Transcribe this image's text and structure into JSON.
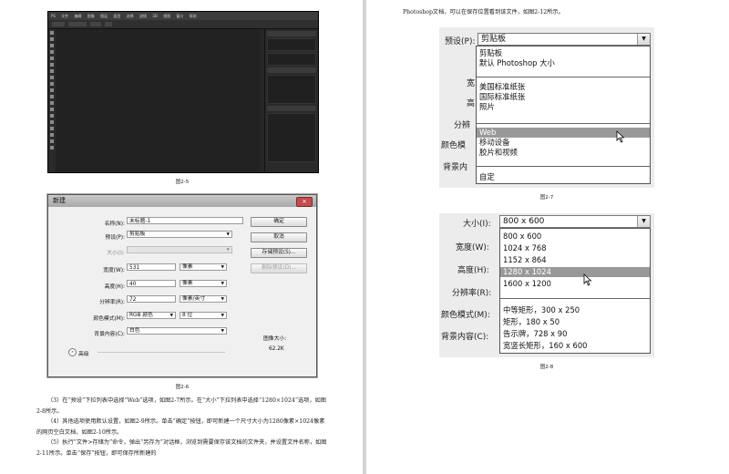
{
  "left_page": {
    "figure5_caption": "图2-5",
    "photoshop": {
      "menu": [
        "PS",
        "文件",
        "编辑",
        "图像",
        "图层",
        "类型",
        "选择",
        "滤镜",
        "3D",
        "视图",
        "窗口",
        "帮助"
      ]
    },
    "new_dialog": {
      "title": "新建",
      "close_label": "✕",
      "name_label": "名称(N):",
      "name_value": "未标题-1",
      "preset_label": "预设(P):",
      "preset_value": "剪贴板",
      "size_label": "大小(I):",
      "width_label": "宽度(W):",
      "width_value": "531",
      "width_unit": "像素",
      "height_label": "高度(H):",
      "height_value": "40",
      "height_unit": "像素",
      "resolution_label": "分辨率(R):",
      "resolution_value": "72",
      "resolution_unit": "像素/英寸",
      "color_mode_label": "颜色模式(M):",
      "color_mode_value": "RGB 颜色",
      "bit_depth_value": "8 位",
      "background_label": "背景内容(C):",
      "background_value": "白色",
      "advanced_label": "高级",
      "ok_label": "确定",
      "cancel_label": "取消",
      "save_preset_label": "存储预设(S)...",
      "delete_preset_label": "删除预设(D)...",
      "image_size_label": "图像大小:",
      "image_size_value": "62.2K"
    },
    "figure6_caption": "图2-6",
    "paragraphs": [
      "（3）在“预设”下拉列表中选择“Web”选项，如图2-7所示。在“大小”下拉列表中选择“1280×1024”选项，如图2-8所示。",
      "（4）其他选项使用默认设置，如图2-9所示。单击“确定”按钮，即可新建一个尺寸大小为1280像素×1024像素的网页空白文档，如图2-10所示。",
      "（5）执行“文件>存储为”命令，弹出“另存为”对话框，浏览到需要保存该文档的文件夹，并设置文件名称，如图2-11所示。单击“保存”按钮，即可保存所新建的"
    ]
  },
  "right_page": {
    "intro": "Photoshop文档，可以在保存位置看到该文件，如图2-12所示。",
    "figure7": {
      "label": "预设(P):",
      "value": "剪贴板",
      "bg_labels": [
        "宽",
        "高",
        "分辨",
        "颜色模",
        "背景内"
      ],
      "options": [
        "剪贴板",
        "默认 Photoshop 大小",
        "美国标准纸张",
        "国际标准纸张",
        "照片",
        "Web",
        "移动设备",
        "胶片和视频",
        "自定"
      ],
      "highlighted": "Web",
      "caption": "图2-7"
    },
    "figure8": {
      "label": "大小(I):",
      "value": "800 x 600",
      "bg_labels": [
        "宽度(W):",
        "高度(H):",
        "分辨率(R):",
        "颜色模式(M):",
        "背景内容(C):"
      ],
      "options": [
        "800 x 600",
        "1024 x 768",
        "1152 x 864",
        "1280 x 1024",
        "1600 x 1200",
        "中等矩形，300 x 250",
        "矩形，180 x 50",
        "告示牌，728 x 90",
        "宽竖长矩形，160 x 600"
      ],
      "highlighted": "1280 x 1024",
      "caption": "图2-8"
    }
  }
}
